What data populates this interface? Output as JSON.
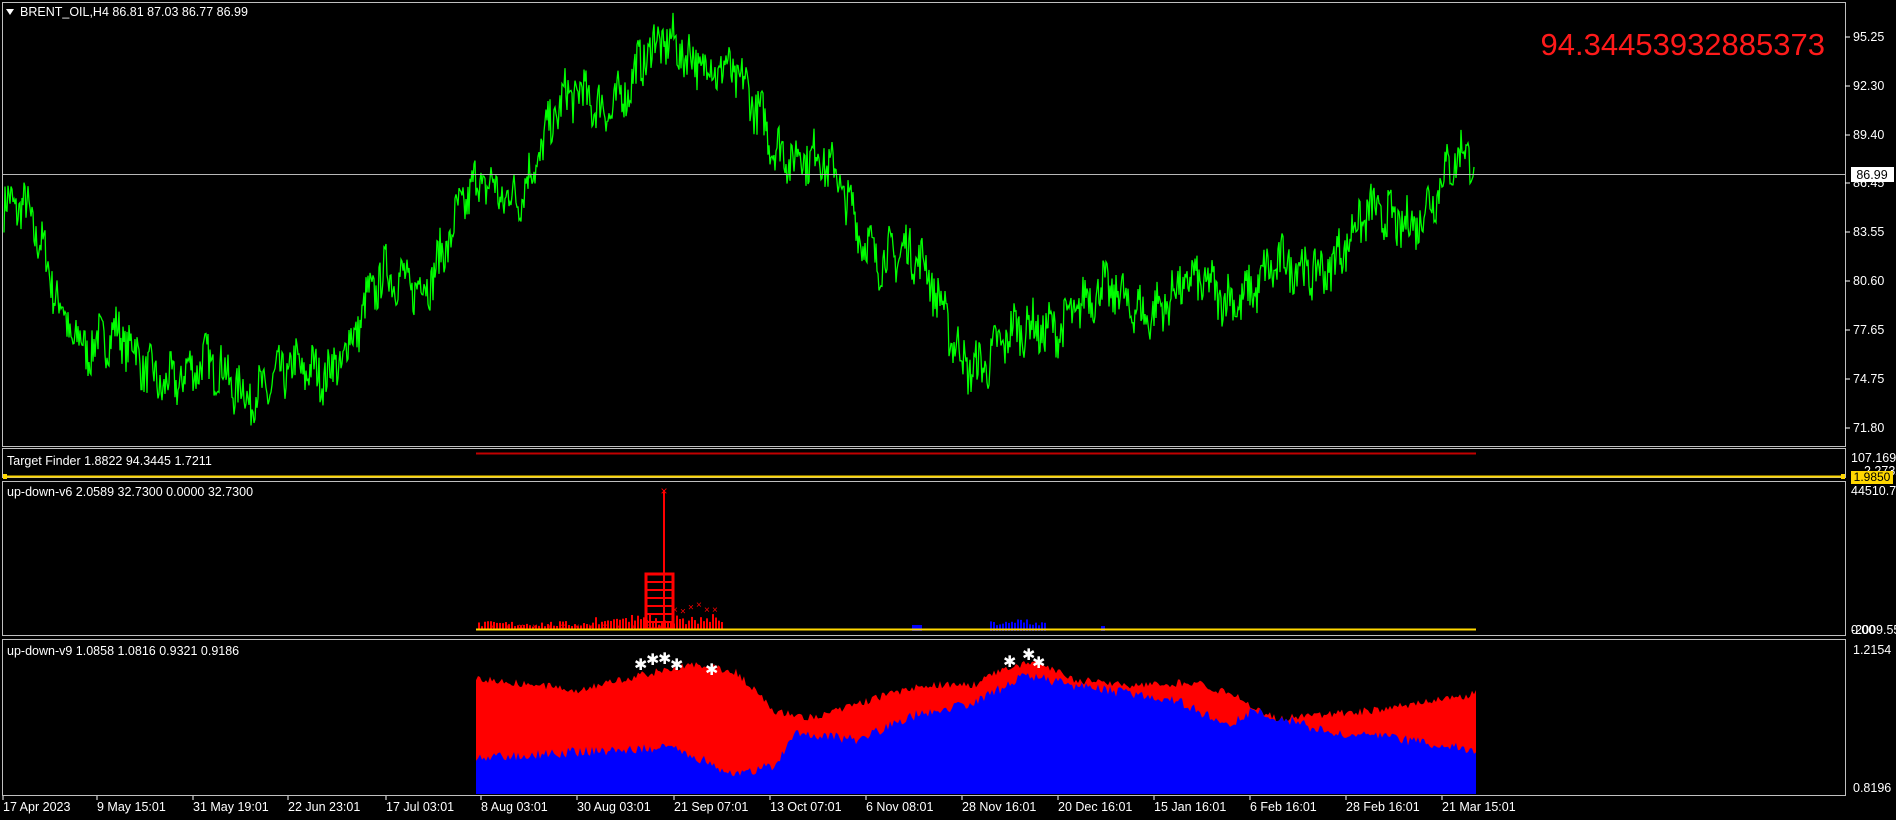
{
  "main": {
    "header": "BRENT_OIL,H4  86.81 87.03 86.77 86.99",
    "target_value": "94.34453932885373",
    "price_ticks": [
      "95.25",
      "92.30",
      "89.40",
      "86.45",
      "83.55",
      "80.60",
      "77.65",
      "74.75",
      "71.80"
    ],
    "current_price": "86.99"
  },
  "target_finder": {
    "header": "Target Finder 1.8822 94.3445 1.7211",
    "ticks": [
      "107.169",
      "2.2732"
    ],
    "current": "1.9850"
  },
  "updown_v6": {
    "header": "up-down-v6 2.0589 32.7300 0.0000 32.7300",
    "ticks": [
      "44510.7",
      "-2009.55",
      "0.00"
    ]
  },
  "updown_v9": {
    "header": "up-down-v9 1.0858 1.0816 0.9321 0.9186",
    "ticks": [
      "1.2154",
      "0.8196"
    ]
  },
  "time_axis": [
    "17 Apr 2023",
    "9 May 15:01",
    "31 May 19:01",
    "22 Jun 23:01",
    "17 Jul 03:01",
    "8 Aug 03:01",
    "30 Aug 03:01",
    "21 Sep 07:01",
    "13 Oct 07:01",
    "6 Nov 08:01",
    "28 Nov 16:01",
    "20 Dec 16:01",
    "15 Jan 16:01",
    "6 Feb 16:01",
    "28 Feb 16:01",
    "21 Mar 15:01"
  ],
  "colors": {
    "price": "#00ff00",
    "target": "#ff0000",
    "up": "#ff0000",
    "down": "#0000ff",
    "level": "#ffd700"
  },
  "icons": {
    "menu": "triangle-down-icon"
  },
  "chart_data": {
    "type": "line",
    "title": "BRENT_OIL,H4",
    "categories": [
      "17 Apr 2023",
      "9 May",
      "31 May",
      "22 Jun",
      "17 Jul",
      "8 Aug",
      "30 Aug",
      "21 Sep",
      "13 Oct",
      "6 Nov",
      "28 Nov",
      "20 Dec",
      "15 Jan",
      "6 Feb",
      "28 Feb",
      "21 Mar"
    ],
    "series": [
      {
        "name": "BRENT_OIL",
        "values": [
          84.5,
          76.5,
          74.8,
          74.5,
          80.0,
          85.5,
          91.0,
          94.0,
          88.5,
          82.5,
          76.0,
          79.0,
          79.5,
          80.5,
          83.5,
          86.99
        ]
      }
    ],
    "ylim": [
      71.2,
      96.3
    ]
  }
}
